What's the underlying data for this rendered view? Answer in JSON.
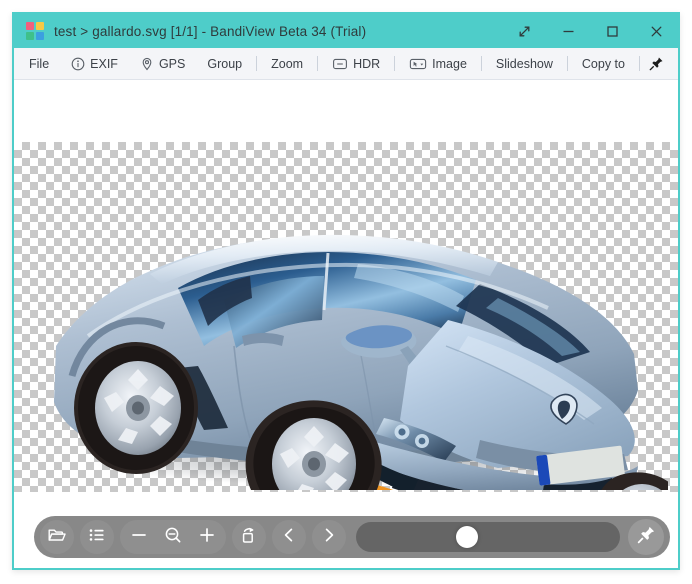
{
  "window": {
    "title": "test > gallardo.svg [1/1] - BandiView Beta 34 (Trial)",
    "accent_color": "#4ecdc9",
    "controls": [
      {
        "name": "restore-expand",
        "label": "Expand"
      },
      {
        "name": "minimize",
        "label": "Minimize"
      },
      {
        "name": "maximize",
        "label": "Maximize"
      },
      {
        "name": "close",
        "label": "Close"
      }
    ]
  },
  "app_icon": {
    "squares": [
      "#f2607e",
      "#f6c945",
      "#3fc08a",
      "#3b9fe0"
    ]
  },
  "toolbar": {
    "items": [
      {
        "label": "File",
        "icon": ""
      },
      {
        "label": "EXIF",
        "icon": "info-icon"
      },
      {
        "label": "GPS",
        "icon": "map-pin-icon"
      },
      {
        "label": "Group",
        "icon": ""
      },
      {
        "label": "Zoom",
        "icon": ""
      },
      {
        "label": "HDR",
        "icon": "hdr-box-icon"
      },
      {
        "label": "Image",
        "icon": "image-select-icon"
      },
      {
        "label": "Slideshow",
        "icon": ""
      },
      {
        "label": "Copy to",
        "icon": ""
      }
    ],
    "pin": {
      "icon": "pin-icon",
      "label": "Always on top"
    }
  },
  "viewer": {
    "file_name": "gallardo.svg",
    "index_label": "[1/1]",
    "background": "checkerboard-transparency",
    "image_alt": "Silver-blue Lamborghini Gallardo sports car, front three-quarter view"
  },
  "bottombar": {
    "buttons": [
      {
        "name": "open-folder-button",
        "icon": "folder-icon"
      },
      {
        "name": "thumbnail-list-button",
        "icon": "list-icon"
      }
    ],
    "zoom_group": [
      {
        "name": "zoom-out-minus-button",
        "icon": "minus-icon"
      },
      {
        "name": "zoom-fit-button",
        "icon": "magnifier-icon"
      },
      {
        "name": "zoom-in-plus-button",
        "icon": "plus-icon"
      }
    ],
    "nav": [
      {
        "name": "rotate-button",
        "icon": "rotate-icon"
      },
      {
        "name": "previous-image-button",
        "icon": "chevron-left-icon"
      },
      {
        "name": "next-image-button",
        "icon": "chevron-right-icon"
      }
    ],
    "slider": {
      "name": "image-position-slider",
      "value_percent": 42
    },
    "pin": {
      "name": "pin-toolbar-button",
      "icon": "pin-icon"
    }
  }
}
